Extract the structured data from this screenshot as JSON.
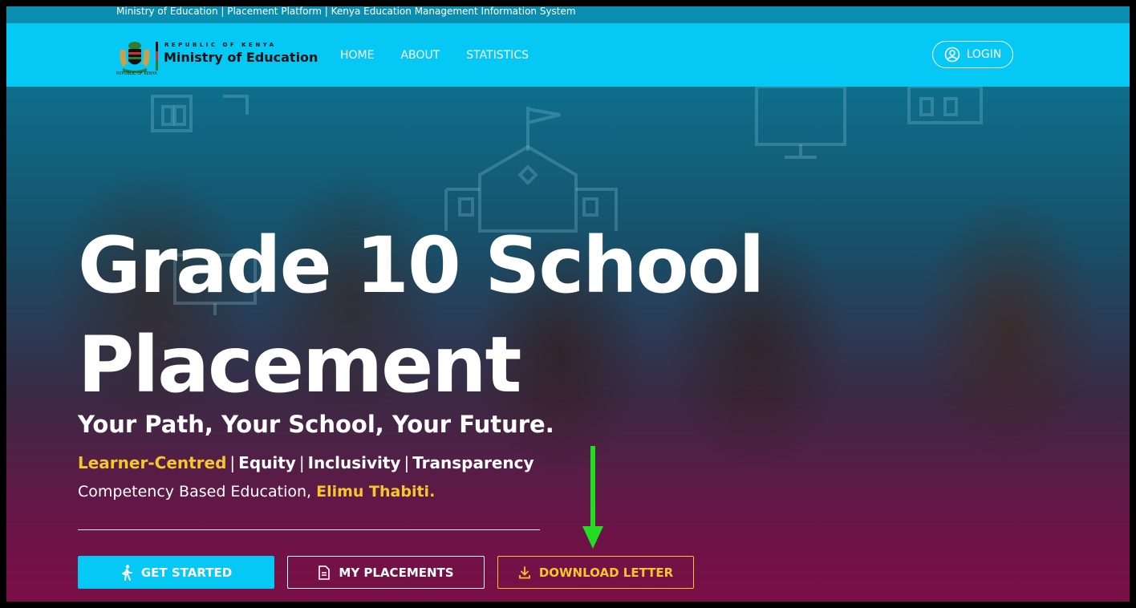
{
  "topbar": {
    "text": "Ministry of Education | Placement Platform | Kenya Education Management Information System"
  },
  "header": {
    "logo": {
      "line1": "REPUBLIC OF KENYA",
      "line2": "Ministry of Education",
      "seal_caption": "REPUBLIC OF KENYA"
    },
    "nav": [
      {
        "label": "HOME"
      },
      {
        "label": "ABOUT"
      },
      {
        "label": "STATISTICS"
      }
    ],
    "login_label": "LOGIN"
  },
  "hero": {
    "title_line1": "Grade 10 School",
    "title_line2": "Placement",
    "subtitle": "Your Path, Your School, Your Future.",
    "values": {
      "v1": "Learner-Centred",
      "sep": "|",
      "v2": "Equity",
      "v3": "Inclusivity",
      "v4": "Transparency"
    },
    "cbe": {
      "text": "Competency Based Education,",
      "highlight": "Elimu Thabiti."
    },
    "buttons": {
      "get_started": "GET STARTED",
      "my_placements": "MY PLACEMENTS",
      "download_letter": "DOWNLOAD LETTER"
    }
  },
  "colors": {
    "nav_bg": "#05c8f5",
    "topbar_bg": "#0b8fb0",
    "accent_yellow": "#f7c62d",
    "annotation_arrow": "#22dd22"
  }
}
